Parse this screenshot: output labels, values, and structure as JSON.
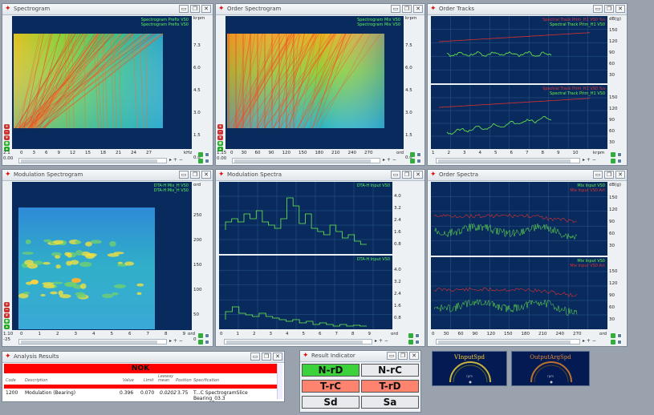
{
  "windows": {
    "spectrogram": {
      "title": "Spectrogram",
      "legend": [
        "Spectrogram Prefix VS0",
        "Spectrogram Prefix VS0"
      ],
      "x_unit": "kHz",
      "y_unit": "krpm",
      "x_ticks": [
        "0",
        "3",
        "6",
        "9",
        "12",
        "15",
        "18",
        "21",
        "24",
        "27"
      ],
      "y_ticks": [
        "7.3",
        "6.0",
        "4.5",
        "3.0",
        "1.5",
        "0.0"
      ],
      "range_low": "0.00",
      "range_high": "2.1"
    },
    "order_spectrogram": {
      "title": "Order Spectrogram",
      "legend": [
        "Spectrogram Mix VS0",
        "Spectrogram Mix VS0"
      ],
      "x_unit": "ord",
      "y_unit": "krpm",
      "x_ticks": [
        "0",
        "30",
        "60",
        "90",
        "120",
        "150",
        "180",
        "210",
        "240",
        "270"
      ],
      "y_ticks": [
        "7.5",
        "6.0",
        "4.5",
        "3.0",
        "1.5",
        "0.0"
      ],
      "range_low": "0.00",
      "range_high": "1.15"
    },
    "order_tracks": {
      "title": "Order Tracks",
      "legend_top": [
        "Spectral Track Prim_H1 VS0 %s",
        "Spectral Track Prim_H1 VS0"
      ],
      "legend_bottom": [
        "Spectral Track Prim_H1 VS0 %s",
        "Spectral Track Prim_H1 VS0"
      ],
      "y_unit": "dB(g)",
      "x_unit": "krpm",
      "y_ticks_top": [
        "150",
        "120",
        "90",
        "60",
        "30"
      ],
      "y_ticks_bottom": [
        "150",
        "120",
        "90",
        "60",
        "30"
      ],
      "x_ticks": [
        "1",
        "2",
        "3",
        "4",
        "5",
        "6",
        "7",
        "8",
        "9",
        "10"
      ]
    },
    "modulation_spectrogram": {
      "title": "Modulation Spectrogram",
      "legend": [
        "DTA-H Mix_H VS0",
        "DTA-H Mix_H VS0"
      ],
      "y_unit": "ord",
      "x_unit": "ord",
      "y_ticks": [
        "250",
        "200",
        "150",
        "100",
        "50",
        "0"
      ],
      "x_ticks": [
        "0",
        "1",
        "2",
        "3",
        "4",
        "5",
        "6",
        "7",
        "8",
        "9"
      ],
      "range_low": "1.10",
      "range_high": "-25"
    },
    "modulation_spectra": {
      "title": "Modulation Spectra",
      "legend_top": "DTA-H Input VS0",
      "legend_bottom": "DTA-H Input VS0",
      "y_ticks_top": [
        "4.0",
        "3.2",
        "2.4",
        "1.6",
        "0.8"
      ],
      "y_ticks_bottom": [
        "4.0",
        "3.2",
        "2.4",
        "1.6",
        "0.8"
      ],
      "x_ticks": [
        "0",
        "1",
        "2",
        "3",
        "4",
        "5",
        "6",
        "7",
        "8",
        "9"
      ],
      "x_unit": "ord"
    },
    "order_spectra": {
      "title": "Order Spectra",
      "legend_top": [
        "Mix Input VS0",
        "Mix Input VS0 Art"
      ],
      "legend_bottom": [
        "Mix Input VS0",
        "Mix Input VS0 Art"
      ],
      "y_unit": "dB(g)",
      "y_ticks_top": [
        "150",
        "120",
        "90",
        "60",
        "30"
      ],
      "y_ticks_bottom": [
        "150",
        "120",
        "90",
        "60",
        "30"
      ],
      "x_ticks": [
        "0",
        "30",
        "60",
        "90",
        "120",
        "150",
        "180",
        "210",
        "240",
        "270"
      ],
      "x_unit": "ord"
    }
  },
  "analysis_results": {
    "title": "Analysis Results",
    "status": "NOK",
    "columns": [
      "Code",
      "Description",
      "Value",
      "Limit",
      "Leeway mean",
      "Position",
      "Specification"
    ],
    "row": {
      "code": "1200",
      "description": "Modulation (Bearing)",
      "value": "0.396",
      "limit": "0.070",
      "leeway": "0.0202",
      "position": "3.75",
      "specification": "T...C  SpectrogramSlice Bearing_03.3"
    }
  },
  "result_indicator": {
    "title": "Result Indicator",
    "buttons": [
      {
        "label": "N-rD",
        "color": "#3cd23c"
      },
      {
        "label": "N-rC",
        "color": "#e8eaee"
      },
      {
        "label": "T-rC",
        "color": "#ff8470"
      },
      {
        "label": "T-rD",
        "color": "#ff8470"
      },
      {
        "label": "Sd",
        "color": "#e8eaee"
      },
      {
        "label": "Sa",
        "color": "#e8eaee"
      }
    ]
  },
  "gauges": [
    {
      "title": "VInputSpd",
      "unit": "rpm",
      "title_color": "#ffd23c"
    },
    {
      "title": "OutputArgSpd",
      "unit": "rpm",
      "title_color": "#e88a3a"
    }
  ],
  "colors": {
    "plot_bg": "#082a5c",
    "track_red": "#e33030",
    "track_green": "#7ef04a",
    "nok_red": "#ff0000"
  }
}
